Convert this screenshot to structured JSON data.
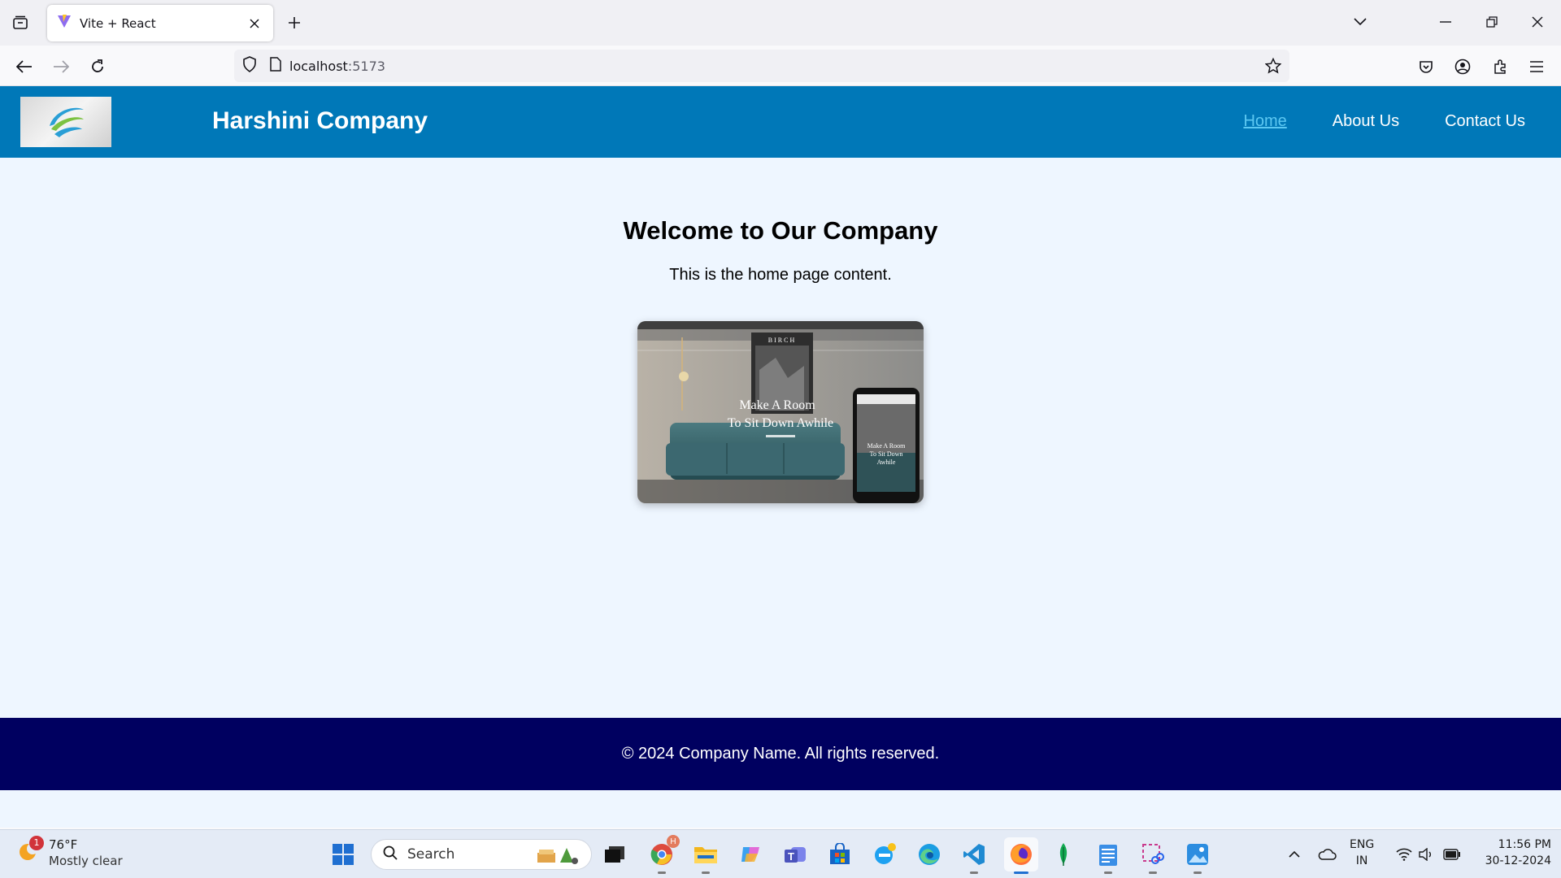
{
  "browser": {
    "tab_title": "Vite + React",
    "url_host": "localhost",
    "url_port": ":5173"
  },
  "site": {
    "company_name": "Harshini Company",
    "nav": [
      {
        "label": "Home",
        "active": true
      },
      {
        "label": "About Us",
        "active": false
      },
      {
        "label": "Contact Us",
        "active": false
      }
    ],
    "heading": "Welcome to Our Company",
    "body_text": "This is the home page content.",
    "hero_image": {
      "brand": "BIRCH",
      "tagline_line1": "Make A Room",
      "tagline_line2": "To Sit Down Awhile"
    },
    "footer_text": "© 2024 Company Name. All rights reserved.",
    "colors": {
      "header_bg": "#0078b8",
      "page_bg": "#eef6ff",
      "footer_bg": "#000060",
      "active_link": "#5cc8f2"
    }
  },
  "taskbar": {
    "weather_temp": "76°F",
    "weather_condition": "Mostly clear",
    "weather_badge": "1",
    "search_placeholder": "Search",
    "language_line1": "ENG",
    "language_line2": "IN",
    "time": "11:56 PM",
    "date": "30-12-2024"
  }
}
